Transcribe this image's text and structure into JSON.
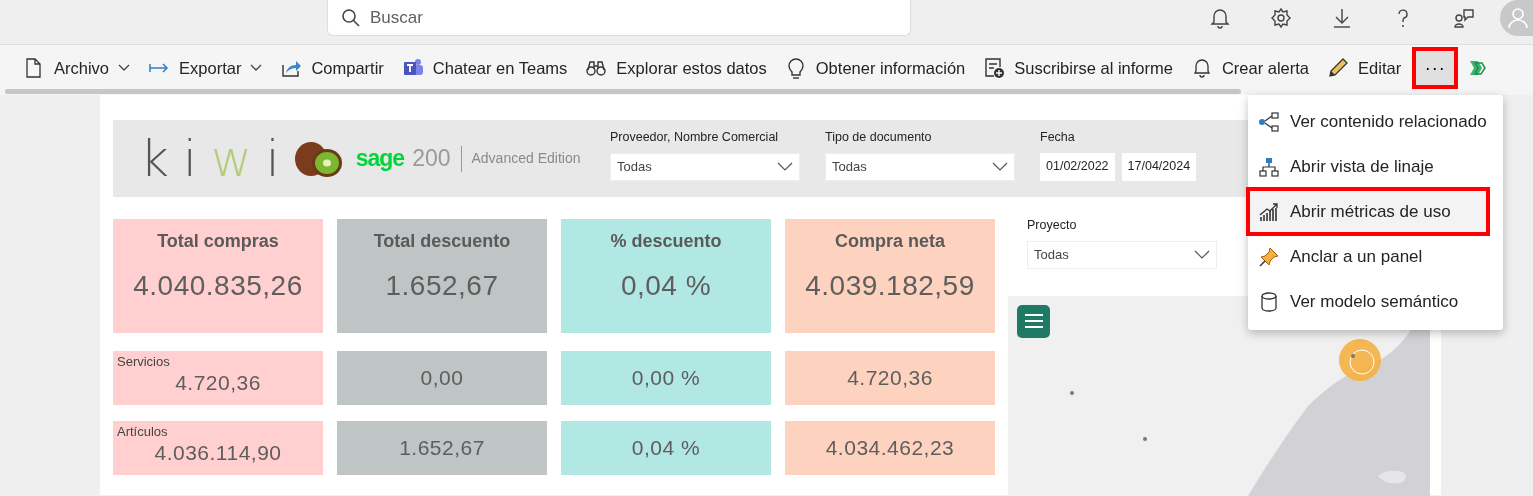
{
  "top_bar": {
    "search": {
      "placeholder": "Buscar"
    }
  },
  "toolbar": {
    "items": [
      {
        "label": "Archivo",
        "has_menu": true
      },
      {
        "label": "Exportar",
        "has_menu": true
      },
      {
        "label": "Compartir",
        "has_menu": false
      },
      {
        "label": "Chatear en Teams",
        "has_menu": false
      },
      {
        "label": "Explorar estos datos",
        "has_menu": false
      },
      {
        "label": "Obtener información",
        "has_menu": false
      },
      {
        "label": "Suscribirse al informe",
        "has_menu": false
      },
      {
        "label": "Crear alerta",
        "has_menu": false
      },
      {
        "label": "Editar",
        "has_menu": false
      }
    ],
    "more": {
      "label": "···",
      "highlighted": true
    }
  },
  "report": {
    "logo": {
      "brand_letters": [
        {
          "text": "k",
          "color": "#555555"
        },
        {
          "text": "i",
          "color": "#555555"
        },
        {
          "text": "w",
          "color": "#b5cc7a"
        },
        {
          "text": "i",
          "color": "#555555"
        }
      ],
      "product": "sage",
      "version": "200",
      "edition": "Advanced Edition"
    },
    "header_filters": [
      {
        "kind": "dropdown",
        "label": "Proveedor, Nombre Comercial",
        "value": "Todas"
      },
      {
        "kind": "dropdown",
        "label": "Tipo de documento",
        "value": "Todas"
      },
      {
        "kind": "date_range",
        "label": "Fecha",
        "values": [
          "01/02/2022",
          "17/04/2024"
        ]
      }
    ],
    "side_filters": [
      {
        "kind": "dropdown",
        "label": "Proyecto",
        "value": "Todas"
      }
    ],
    "kpi_columns": [
      {
        "title": "Total compras",
        "value": "4.040.835,26",
        "color": "#ffd0cf",
        "rows": [
          {
            "label": "Servicios",
            "value": "4.720,36"
          },
          {
            "label": "Artículos",
            "value": "4.036.114,90"
          }
        ]
      },
      {
        "title": "Total descuento",
        "value": "1.652,67",
        "color": "#bfc4c4",
        "rows": [
          {
            "value": "0,00"
          },
          {
            "value": "1.652,67"
          }
        ]
      },
      {
        "title": "% descuento",
        "value": "0,04 %",
        "color": "#b2e8e4",
        "rows": [
          {
            "value": "0,00 %"
          },
          {
            "value": "0,04 %"
          }
        ]
      },
      {
        "title": "Compra neta",
        "value": "4.039.182,59",
        "color": "#fdd3c0",
        "rows": [
          {
            "value": "4.720,36"
          },
          {
            "value": "4.034.462,23"
          }
        ]
      }
    ]
  },
  "context_menu": {
    "items": [
      {
        "label": "Ver contenido relacionado",
        "highlighted": false
      },
      {
        "label": "Abrir vista de linaje",
        "highlighted": false
      },
      {
        "label": "Abrir métricas de uso",
        "highlighted": true
      },
      {
        "label": "Anclar a un panel",
        "highlighted": false
      },
      {
        "label": "Ver modelo semántico",
        "highlighted": false
      }
    ]
  }
}
